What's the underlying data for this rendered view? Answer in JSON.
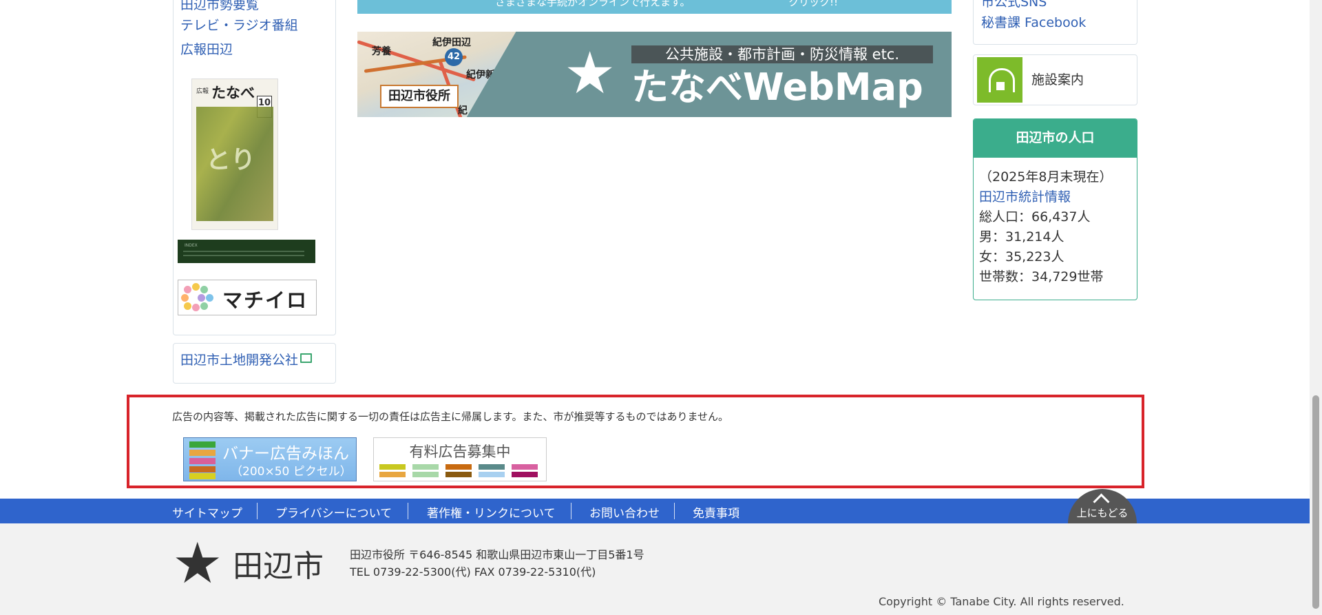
{
  "left_sidebar": {
    "links": [
      "田辺市勢要覧",
      "テレビ・ラジオ番組",
      "広報田辺"
    ],
    "magazine": {
      "brand": "広報",
      "title": "たなべ",
      "issue": "10"
    },
    "machiiro": "マチイロ",
    "land_corp": "田辺市土地開発公社"
  },
  "top_banner": {
    "text": "さまざまな手続がオンラインで行えます。",
    "cta": "クリック!!"
  },
  "webmap": {
    "map_labels": [
      "紀伊田辺",
      "芳養",
      "紀伊新庄",
      "紀"
    ],
    "route": "42",
    "city_hall": "田辺市役所",
    "tagline": "公共施設・都市計画・防災情報 etc.",
    "title": "たなべWebMap"
  },
  "right_sidebar": {
    "links": [
      "市公式SNS",
      "秘書課 Facebook"
    ],
    "facility": "施設案内",
    "population": {
      "heading": "田辺市の人口",
      "as_of": "（2025年8月末現在）",
      "stats_link": "田辺市統計情報",
      "total": "総人口：66,437人",
      "male": "男：31,214人",
      "female": "女：35,223人",
      "households": "世帯数：34,729世帯"
    }
  },
  "ads": {
    "note": "広告の内容等、掲載された広告に関する一切の責任は広告主に帰属します。また、市が推奨等するものではありません。",
    "sample_title": "バナー広告みほん",
    "sample_size": "（200×50 ピクセル）",
    "recruit": "有料広告募集中"
  },
  "footer": {
    "nav": [
      "サイトマップ",
      "プライバシーについて",
      "著作権・リンクについて",
      "お問い合わせ",
      "免責事項"
    ],
    "to_top": "上にもどる",
    "city_name": "田辺市",
    "address": "田辺市役所 〒646-8545 和歌山県田辺市東山一丁目5番1号",
    "tel": "TEL 0739-22-5300(代) FAX 0739-22-5310(代)",
    "copyright": "Copyright © Tanabe City. All rights reserved."
  },
  "colors": {
    "footer_nav": "#2f64cc",
    "ad_frame": "#d8232a",
    "population_accent": "#3bad8c",
    "link": "#2f5fb3"
  }
}
